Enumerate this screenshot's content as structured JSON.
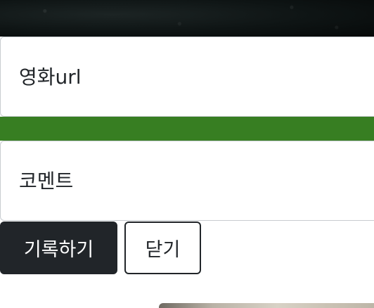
{
  "form": {
    "url_placeholder": "영화url",
    "url_value": "",
    "comment_placeholder": "코멘트",
    "comment_value": "",
    "record_button_label": "기록하기",
    "close_button_label": "닫기"
  },
  "colors": {
    "green_band": "#377e22",
    "primary_button": "#212529",
    "field_border": "#c8ccd0"
  }
}
